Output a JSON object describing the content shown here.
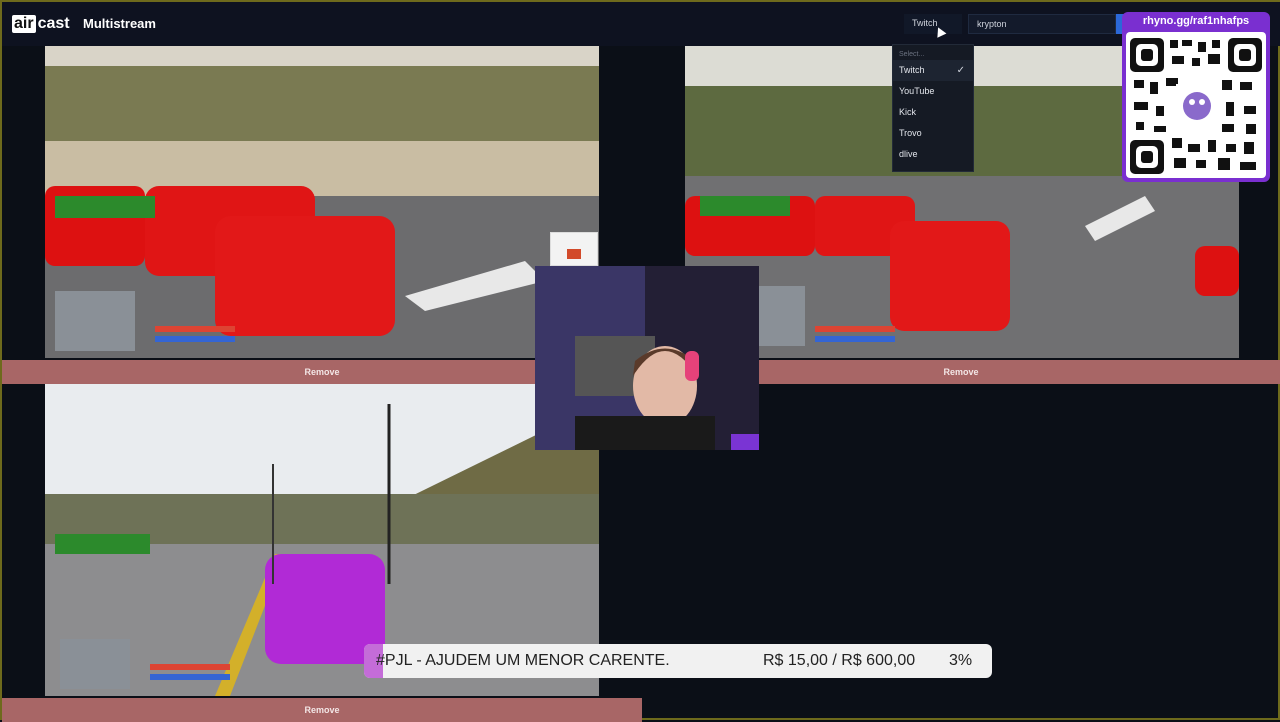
{
  "header": {
    "logo_air": "air",
    "logo_cast": "cast",
    "title": "Multistream",
    "platform_value": "Twitch",
    "channel_value": "krypton"
  },
  "dropdown": {
    "header": "Select...",
    "options": [
      "Twitch",
      "YouTube",
      "Kick",
      "Trovo",
      "dlive"
    ],
    "selected": "Twitch"
  },
  "tiles": [
    {
      "remove_label": "Remove"
    },
    {
      "remove_label": "Remove"
    },
    {
      "remove_label": "Remove"
    }
  ],
  "qr": {
    "title": "rhyno.gg/raf1nhafps"
  },
  "goal": {
    "text": "#PJL - AJUDEM UM MENOR CARENTE.",
    "amount": "R$ 15,00 / R$ 600,00",
    "percent_label": "3%",
    "progress": 0.03
  },
  "colors": {
    "accent": "#7a2fd0",
    "remove_bar": "#a86666",
    "header_bg": "#0e1220"
  }
}
